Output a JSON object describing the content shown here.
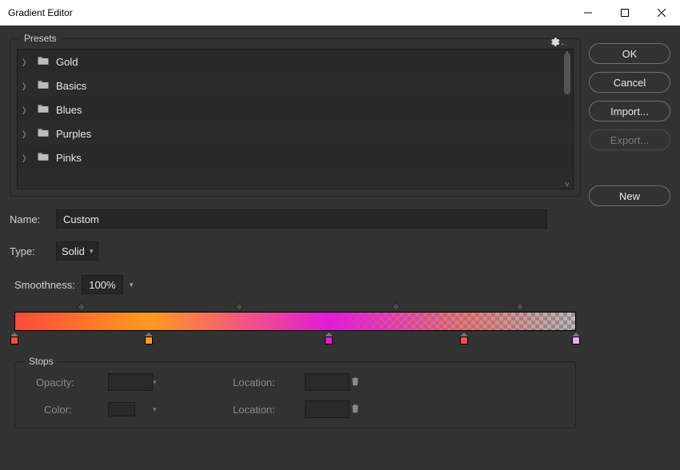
{
  "window": {
    "title": "Gradient Editor"
  },
  "buttons": {
    "ok": "OK",
    "cancel": "Cancel",
    "import": "Import...",
    "export": "Export...",
    "new": "New"
  },
  "presets": {
    "legend": "Presets",
    "items": [
      {
        "label": "Gold"
      },
      {
        "label": "Basics"
      },
      {
        "label": "Blues"
      },
      {
        "label": "Purples"
      },
      {
        "label": "Pinks"
      }
    ]
  },
  "name": {
    "label": "Name:",
    "value": "Custom"
  },
  "type": {
    "label": "Type:",
    "value": "Solid"
  },
  "smoothness": {
    "label": "Smoothness:",
    "value": "100%"
  },
  "gradient": {
    "stops": [
      {
        "position": 0,
        "color": "#ff4a3c"
      },
      {
        "position": 24,
        "color": "#ff9a1f"
      },
      {
        "position": 56,
        "color": "#e21bd8"
      },
      {
        "position": 80,
        "color": "#ff4a4a"
      },
      {
        "position": 100,
        "color": "#f0a8e8"
      }
    ],
    "midpoints": [
      12,
      40,
      68,
      90
    ],
    "css": "linear-gradient(to right, #ff4a3c 0%, #ff9a1f 24%, #e21bd8 56%, rgba(255,74,74,0.55) 80%, rgba(240,168,232,0) 100%)"
  },
  "stopsPanel": {
    "legend": "Stops",
    "opacityLabel": "Opacity:",
    "colorLabel": "Color:",
    "locationLabel": "Location:"
  }
}
